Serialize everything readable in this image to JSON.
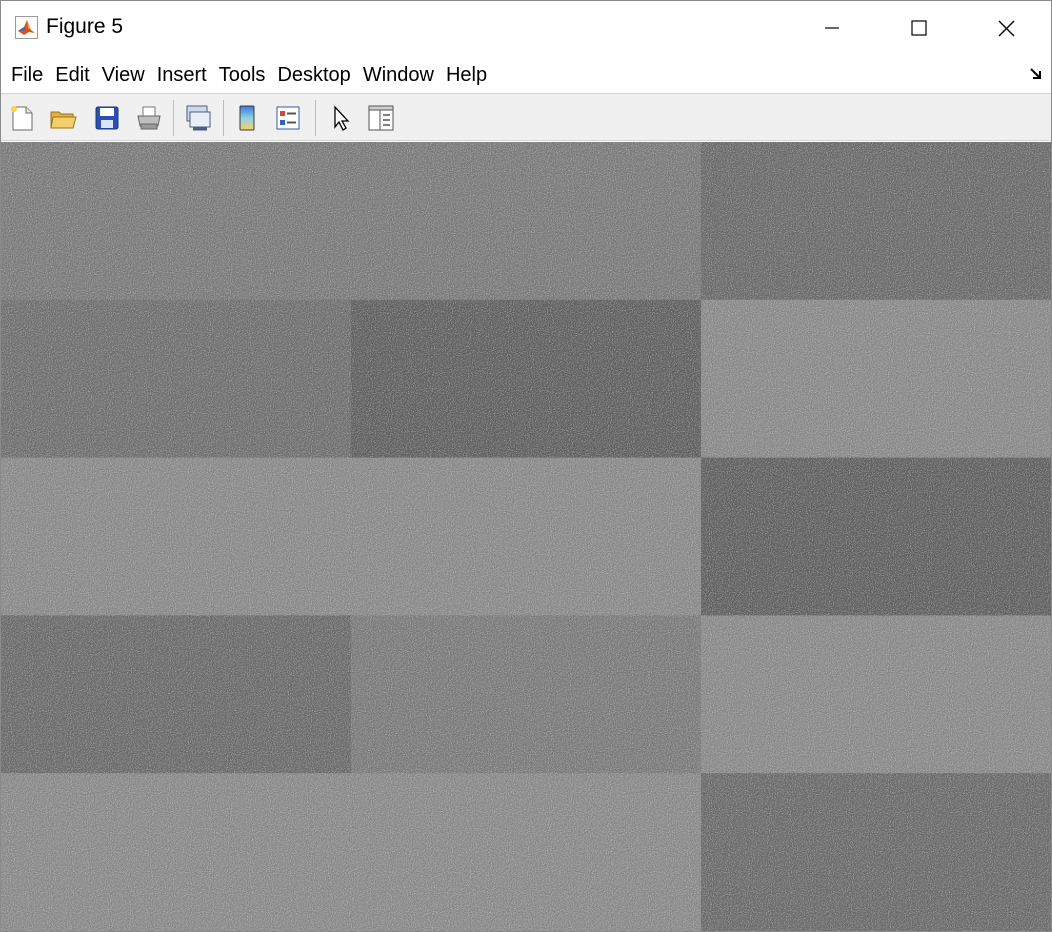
{
  "window": {
    "title": "Figure 5",
    "app_icon": "matlab-logo-icon",
    "controls": [
      "minimize-icon",
      "maximize-icon",
      "close-icon"
    ]
  },
  "menubar": {
    "items": [
      "File",
      "Edit",
      "View",
      "Insert",
      "Tools",
      "Desktop",
      "Window",
      "Help"
    ],
    "dock_icon": "dock-arrow-icon"
  },
  "toolbar": {
    "buttons": [
      {
        "icon": "new-figure-icon"
      },
      {
        "icon": "open-file-icon"
      },
      {
        "icon": "save-icon"
      },
      {
        "icon": "print-icon"
      },
      {
        "icon": "link-plot-icon"
      },
      {
        "icon": "insert-colorbar-icon"
      },
      {
        "icon": "insert-legend-icon"
      },
      {
        "icon": "edit-plot-pointer-icon"
      },
      {
        "icon": "property-inspector-icon"
      }
    ]
  },
  "figure": {
    "grid_rows": 5,
    "grid_cols": 3,
    "tile_gray_levels": [
      [
        0.5,
        0.5,
        0.44
      ],
      [
        0.46,
        0.4,
        0.56
      ],
      [
        0.56,
        0.56,
        0.4
      ],
      [
        0.44,
        0.5,
        0.56
      ],
      [
        0.56,
        0.56,
        0.44
      ]
    ],
    "noise": "gaussian grayscale"
  }
}
